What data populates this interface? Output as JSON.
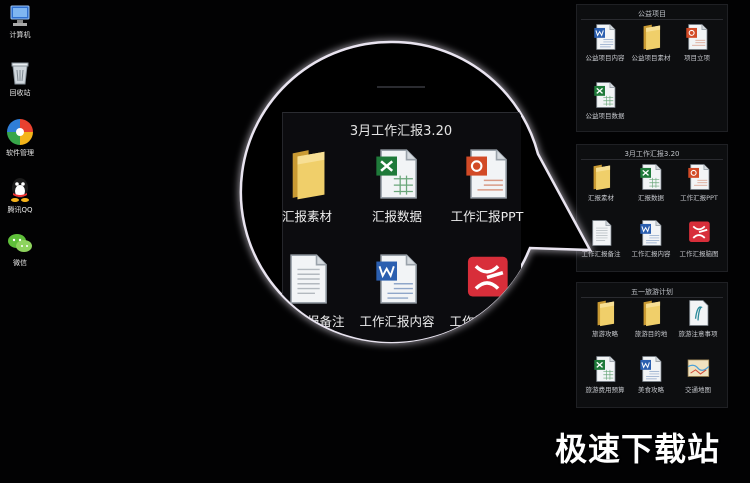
{
  "desktop": {
    "icons": [
      {
        "label": "计算机",
        "icon": "computer-icon"
      },
      {
        "label": "回收站",
        "icon": "recycle-bin-icon"
      },
      {
        "label": "软件管理",
        "icon": "software-manager-icon"
      },
      {
        "label": "腾讯QQ",
        "icon": "qq-icon"
      },
      {
        "label": "微信",
        "icon": "wechat-icon"
      }
    ]
  },
  "fences": [
    {
      "title": "公益项目",
      "items": [
        {
          "label": "公益项目内容",
          "icon": "word-doc-icon"
        },
        {
          "label": "公益项目素材",
          "icon": "folder-icon"
        },
        {
          "label": "项目立项",
          "icon": "ppt-doc-icon"
        },
        {
          "label": "公益项目数据",
          "icon": "excel-doc-icon"
        }
      ]
    },
    {
      "title": "3月工作汇报3.20",
      "items": [
        {
          "label": "汇报素材",
          "icon": "folder-icon"
        },
        {
          "label": "汇报数据",
          "icon": "excel-doc-icon"
        },
        {
          "label": "工作汇报PPT",
          "icon": "ppt-doc-icon"
        },
        {
          "label": "工作汇报备注",
          "icon": "text-doc-icon"
        },
        {
          "label": "工作汇报内容",
          "icon": "word-doc-icon"
        },
        {
          "label": "工作汇报脑图",
          "icon": "xmind-icon"
        }
      ]
    },
    {
      "title": "五一旅游计划",
      "items": [
        {
          "label": "旅游攻略",
          "icon": "folder-icon"
        },
        {
          "label": "旅游目的地",
          "icon": "folder-icon"
        },
        {
          "label": "旅游注意事项",
          "icon": "note-doc-icon"
        },
        {
          "label": "旅游费用预算",
          "icon": "excel-doc-icon"
        },
        {
          "label": "美食攻略",
          "icon": "word-doc-icon"
        },
        {
          "label": "交通地图",
          "icon": "map-icon"
        }
      ]
    }
  ],
  "magnifier": {
    "title": "3月工作汇报3.20",
    "items": [
      {
        "label": "汇报素材",
        "icon": "folder-icon"
      },
      {
        "label": "汇报数据",
        "icon": "excel-doc-icon"
      },
      {
        "label": "工作汇报PPT",
        "icon": "ppt-doc-icon"
      },
      {
        "label": "工作汇报备注",
        "icon": "text-doc-icon"
      },
      {
        "label": "工作汇报内容",
        "icon": "word-doc-icon"
      },
      {
        "label": "工作汇报脑图",
        "icon": "xmind-icon"
      }
    ]
  },
  "watermark": "极速下载站",
  "colors": {
    "background": "#020203",
    "excel": "#1f7a3a",
    "word": "#2b5fb0",
    "ppt": "#d24a26",
    "xmind": "#d82e3a",
    "folder": "#e8c25a"
  }
}
